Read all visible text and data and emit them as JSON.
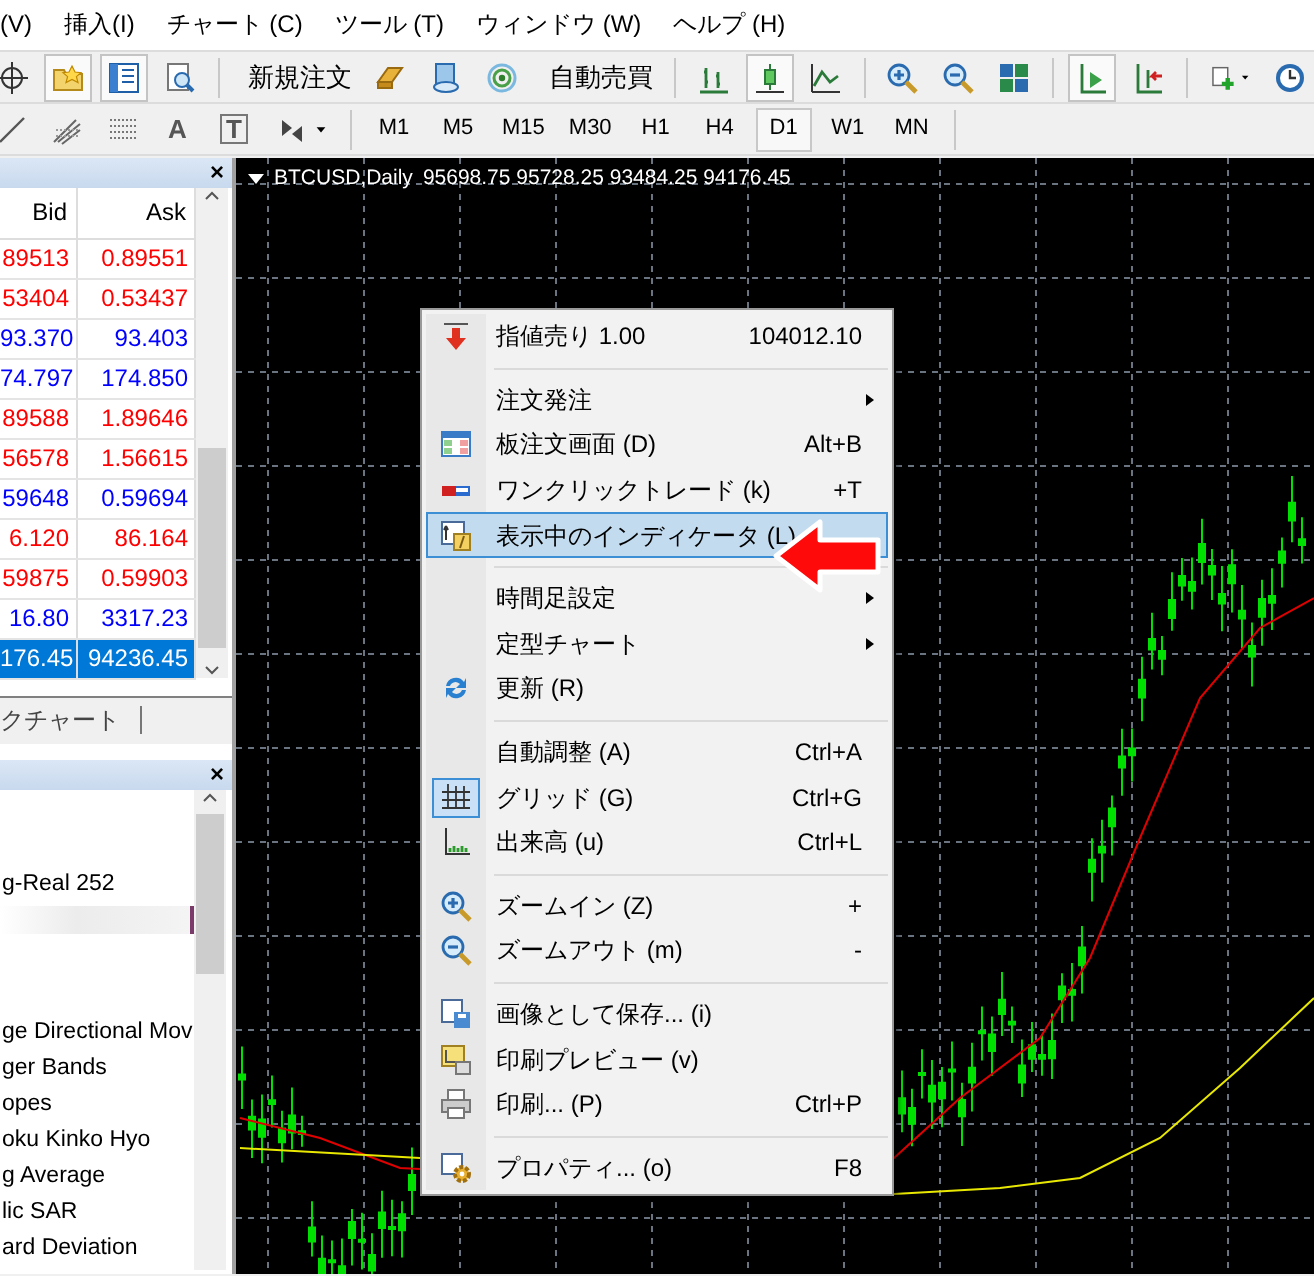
{
  "menu_bar": [
    {
      "label": "(V)"
    },
    {
      "label": "挿入(I)"
    },
    {
      "label": "チャート (C)"
    },
    {
      "label": "ツール (T)"
    },
    {
      "label": "ウィンドウ (W)"
    },
    {
      "label": "ヘルプ (H)"
    }
  ],
  "toolbar": [
    {
      "kind": "button",
      "pressed": false
    },
    {
      "kind": "button",
      "pressed": true
    },
    {
      "kind": "button",
      "pressed": true
    },
    {
      "kind": "button",
      "pressed": false
    },
    {
      "kind": "separator"
    },
    {
      "kind": "button",
      "label": "新規注文",
      "pressed": false
    },
    {
      "kind": "button",
      "pressed": false
    },
    {
      "kind": "button",
      "pressed": false
    },
    {
      "kind": "button",
      "pressed": false
    },
    {
      "kind": "button",
      "label": "自動売買",
      "pressed": false
    },
    {
      "kind": "separator"
    },
    {
      "kind": "button",
      "pressed": false
    },
    {
      "kind": "button",
      "pressed": true
    },
    {
      "kind": "button",
      "pressed": false
    },
    {
      "kind": "separator"
    },
    {
      "kind": "button",
      "pressed": false
    },
    {
      "kind": "button",
      "pressed": false
    },
    {
      "kind": "button",
      "pressed": false
    },
    {
      "kind": "separator"
    },
    {
      "kind": "button",
      "pressed": true
    },
    {
      "kind": "button",
      "pressed": false
    },
    {
      "kind": "separator"
    },
    {
      "kind": "button",
      "pressed": false
    },
    {
      "kind": "button",
      "pressed": false
    }
  ],
  "drawing_tools": [
    {
      "kind": "icon"
    },
    {
      "kind": "icon"
    },
    {
      "kind": "icon"
    },
    {
      "kind": "glyph",
      "glyph": "A"
    },
    {
      "kind": "glyph",
      "glyph": "T"
    },
    {
      "kind": "icon"
    }
  ],
  "timeframes": [
    {
      "label": "M1",
      "selected": false
    },
    {
      "label": "M5",
      "selected": false
    },
    {
      "label": "M15",
      "selected": false
    },
    {
      "label": "M30",
      "selected": false
    },
    {
      "label": "H1",
      "selected": false
    },
    {
      "label": "H4",
      "selected": false
    },
    {
      "label": "D1",
      "selected": true
    },
    {
      "label": "W1",
      "selected": false
    },
    {
      "label": "MN",
      "selected": false
    }
  ],
  "market_watch": {
    "close": "×",
    "columns": [
      "Bid",
      "Ask"
    ],
    "rows": [
      {
        "bid": "89513",
        "ask": "0.89551",
        "color": "#ff0000",
        "selected": false
      },
      {
        "bid": "53404",
        "ask": "0.53437",
        "color": "#ff0000",
        "selected": false
      },
      {
        "bid": "93.370",
        "ask": "93.403",
        "color": "#0000ff",
        "selected": false
      },
      {
        "bid": "74.797",
        "ask": "174.850",
        "color": "#0000ff",
        "selected": false
      },
      {
        "bid": "89588",
        "ask": "1.89646",
        "color": "#ff0000",
        "selected": false
      },
      {
        "bid": "56578",
        "ask": "1.56615",
        "color": "#ff0000",
        "selected": false
      },
      {
        "bid": "59648",
        "ask": "0.59694",
        "color": "#0000ff",
        "selected": false
      },
      {
        "bid": "6.120",
        "ask": "86.164",
        "color": "#ff0000",
        "selected": false
      },
      {
        "bid": "59875",
        "ask": "0.59903",
        "color": "#ff0000",
        "selected": false
      },
      {
        "bid": "16.80",
        "ask": "3317.23",
        "color": "#0000ff",
        "selected": false
      },
      {
        "bid": "176.45",
        "ask": "94236.45",
        "selected": true
      }
    ]
  },
  "panel_tabs": [
    {
      "label": "クチャート"
    }
  ],
  "navigator": {
    "close": "×",
    "items": [
      {
        "kind": "text",
        "label": "g-Real 252"
      },
      {
        "kind": "blurred"
      },
      {
        "kind": "text",
        "label": "ge Directional Mov"
      },
      {
        "kind": "text",
        "label": "ger Bands"
      },
      {
        "kind": "text",
        "label": "opes"
      },
      {
        "kind": "text",
        "label": "oku Kinko Hyo"
      },
      {
        "kind": "text",
        "label": "g Average"
      },
      {
        "kind": "text",
        "label": "lic SAR"
      },
      {
        "kind": "text",
        "label": "ard Deviation"
      }
    ]
  },
  "chart": {
    "symbol": "BTCUSD,Daily",
    "ohlc": "95698.75 95728.25 93484.25 94176.45"
  },
  "context_menu": [
    {
      "kind": "item",
      "label": "指値売り 1.00",
      "shortcut": "104012.10",
      "submenu": false,
      "selected": false,
      "checked": false
    },
    {
      "kind": "separator"
    },
    {
      "kind": "item",
      "label": "注文発注",
      "submenu": true,
      "selected": false,
      "checked": false
    },
    {
      "kind": "item",
      "label": "板注文画面 (D)",
      "shortcut": "Alt+B",
      "submenu": false,
      "selected": false,
      "checked": false
    },
    {
      "kind": "item",
      "label": "ワンクリックトレード (k)",
      "shortcut": "+T",
      "submenu": false,
      "selected": false,
      "checked": false
    },
    {
      "kind": "item",
      "label": "表示中のインディケータ (L)",
      "submenu": false,
      "selected": true,
      "checked": false
    },
    {
      "kind": "separator"
    },
    {
      "kind": "item",
      "label": "時間足設定",
      "submenu": true,
      "selected": false,
      "checked": false
    },
    {
      "kind": "item",
      "label": "定型チャート",
      "submenu": true,
      "selected": false,
      "checked": false
    },
    {
      "kind": "item",
      "label": "更新 (R)",
      "submenu": false,
      "selected": false,
      "checked": false
    },
    {
      "kind": "separator"
    },
    {
      "kind": "item",
      "label": "自動調整 (A)",
      "shortcut": "Ctrl+A",
      "submenu": false,
      "selected": false,
      "checked": false
    },
    {
      "kind": "item",
      "label": "グリッド (G)",
      "shortcut": "Ctrl+G",
      "submenu": false,
      "selected": false,
      "checked": true
    },
    {
      "kind": "item",
      "label": "出来高 (u)",
      "shortcut": "Ctrl+L",
      "submenu": false,
      "selected": false,
      "checked": false
    },
    {
      "kind": "separator"
    },
    {
      "kind": "item",
      "label": "ズームイン (Z)",
      "shortcut": "+",
      "submenu": false,
      "selected": false,
      "checked": false
    },
    {
      "kind": "item",
      "label": "ズームアウト (m)",
      "shortcut": "-",
      "submenu": false,
      "selected": false,
      "checked": false
    },
    {
      "kind": "separator"
    },
    {
      "kind": "item",
      "label": "画像として保存... (i)",
      "submenu": false,
      "selected": false,
      "checked": false
    },
    {
      "kind": "item",
      "label": "印刷プレビュー (v)",
      "submenu": false,
      "selected": false,
      "checked": false
    },
    {
      "kind": "item",
      "label": "印刷... (P)",
      "shortcut": "Ctrl+P",
      "submenu": false,
      "selected": false,
      "checked": false
    },
    {
      "kind": "separator"
    },
    {
      "kind": "item",
      "label": "プロパティ... (o)",
      "shortcut": "F8",
      "submenu": false,
      "selected": false,
      "checked": false
    }
  ]
}
